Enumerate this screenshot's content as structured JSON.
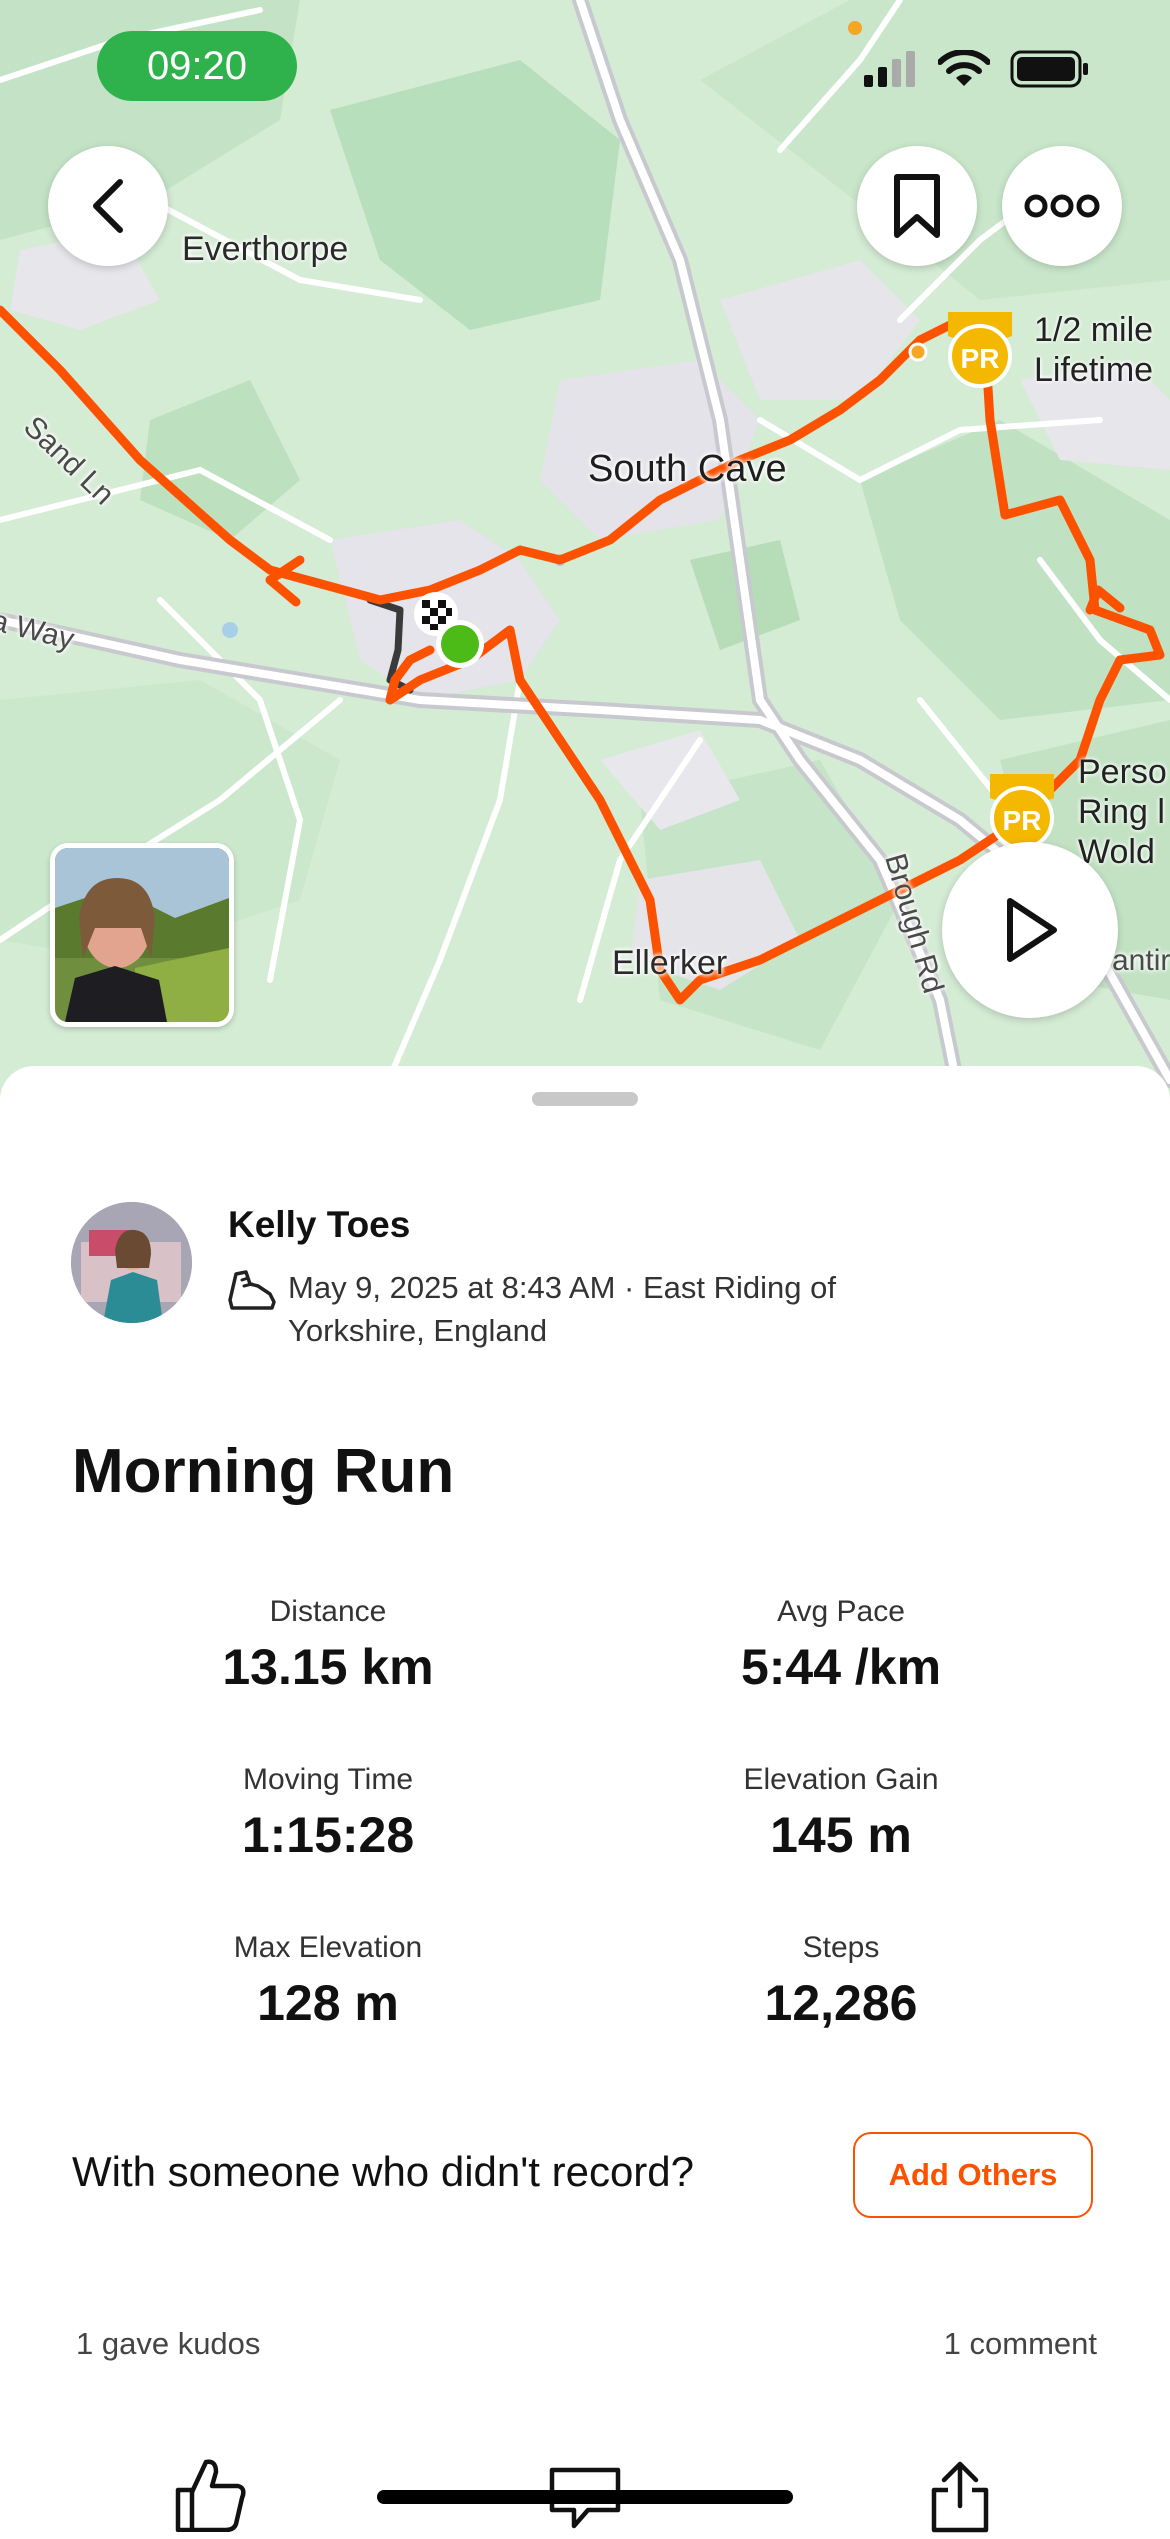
{
  "status_bar": {
    "time": "09:20"
  },
  "map": {
    "labels": {
      "everthorpe": "Everthorpe",
      "south_cave": "South Cave",
      "ellerker": "Ellerker",
      "sand_ln": "Sand Ln",
      "a_way": "a Way",
      "brough_rd": "Brough Rd",
      "antir": "antir"
    },
    "pr_badges": [
      {
        "badge": "PR",
        "line1": "1/2 mile",
        "line2": "Lifetime"
      },
      {
        "badge": "PR",
        "line1": "Perso",
        "line2": "Ring l",
        "line3": "Wold"
      }
    ],
    "route_color": "#fc5200"
  },
  "activity": {
    "athlete_name": "Kelly Toes",
    "meta_line1": "May 9, 2025 at 8:43 AM · East Riding of",
    "meta_line2": "Yorkshire, England",
    "title": "Morning Run",
    "stats": [
      {
        "label": "Distance",
        "value": "13.15 km"
      },
      {
        "label": "Avg Pace",
        "value": "5:44 /km"
      },
      {
        "label": "Moving Time",
        "value": "1:15:28"
      },
      {
        "label": "Elevation Gain",
        "value": "145 m"
      },
      {
        "label": "Max Elevation",
        "value": "128 m"
      },
      {
        "label": "Steps",
        "value": "12,286"
      }
    ],
    "with_someone_prompt": "With someone who didn't record?",
    "add_others_label": "Add Others",
    "kudos_text": "1 gave kudos",
    "comments_text": "1 comment"
  },
  "colors": {
    "accent": "#fc5200",
    "status_pill": "#2fb24c",
    "pr_gold": "#f5b800"
  }
}
